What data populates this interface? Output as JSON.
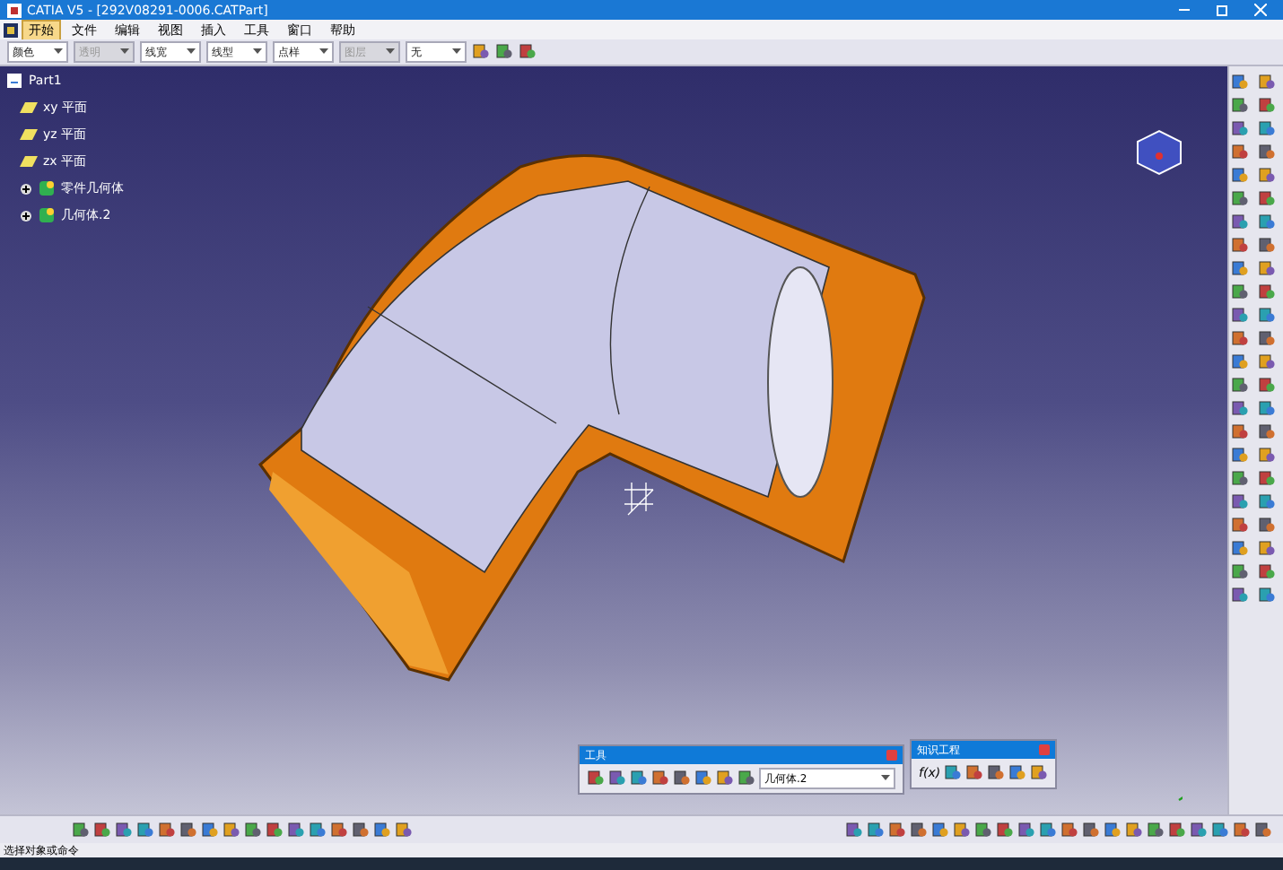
{
  "window": {
    "title": "CATIA V5 - [292V08291-0006.CATPart]"
  },
  "menu": [
    {
      "label": "开始",
      "selected": true
    },
    {
      "label": "文件",
      "selected": false
    },
    {
      "label": "编辑",
      "selected": false
    },
    {
      "label": "视图",
      "selected": false
    },
    {
      "label": "插入",
      "selected": false
    },
    {
      "label": "工具",
      "selected": false
    },
    {
      "label": "窗口",
      "selected": false
    },
    {
      "label": "帮助",
      "selected": false
    }
  ],
  "properties_toolbar": [
    {
      "value": "颜色",
      "disabled": false
    },
    {
      "value": "透明",
      "disabled": true
    },
    {
      "value": "线宽",
      "disabled": false
    },
    {
      "value": "线型",
      "disabled": false
    },
    {
      "value": "点样",
      "disabled": false
    },
    {
      "value": "图层",
      "disabled": true
    },
    {
      "value": "无",
      "disabled": false
    }
  ],
  "tree": {
    "label": "Part1",
    "children": [
      {
        "label": "xy 平面",
        "kind": "plane"
      },
      {
        "label": "yz 平面",
        "kind": "plane"
      },
      {
        "label": "zx 平面",
        "kind": "plane"
      },
      {
        "label": "零件几何体",
        "kind": "body",
        "expanded": false
      },
      {
        "label": "几何体.2",
        "kind": "body",
        "expanded": false
      }
    ]
  },
  "tools_panel": {
    "title": "工具",
    "body_select": "几何体.2"
  },
  "knowledge_panel": {
    "title": "知识工程",
    "formula_label": "f(x)"
  },
  "status_bar": {
    "text": "选择对象或命令"
  }
}
